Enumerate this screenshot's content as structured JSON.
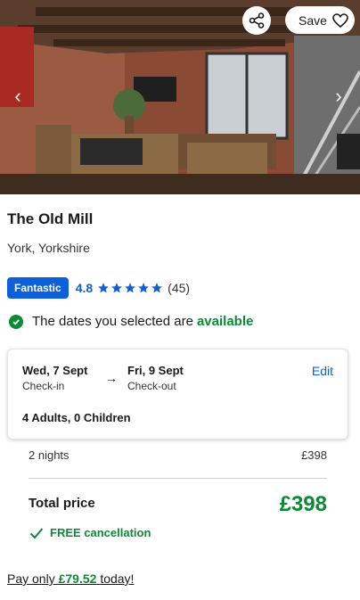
{
  "hero": {
    "save_label": "Save",
    "prev_icon": "chevron-left-icon",
    "next_icon": "chevron-right-icon",
    "share_icon": "share-icon",
    "heart_icon": "heart-icon"
  },
  "property": {
    "name": "The Old Mill",
    "location": "York, Yorkshire"
  },
  "rating": {
    "badge": "Fantastic",
    "score": "4.8",
    "stars": 5,
    "count": "(45)"
  },
  "availability": {
    "prefix": "The dates you selected are",
    "status": "available"
  },
  "booking": {
    "checkin_date": "Wed, 7 Sept",
    "checkin_label": "Check-in",
    "checkout_date": "Fri, 9 Sept",
    "checkout_label": "Check-out",
    "edit_label": "Edit",
    "guests": "4 Adults, 0 Children"
  },
  "pricing": {
    "nights_label": "2 nights",
    "nights_price": "£398",
    "total_label": "Total price",
    "total_amount": "£398",
    "cancellation": "FREE cancellation",
    "pay_prefix": "Pay only",
    "pay_amount": "£79.52",
    "pay_suffix": "today!"
  },
  "colors": {
    "brand_blue": "#0d5fdb",
    "success_green": "#0a8a34"
  }
}
